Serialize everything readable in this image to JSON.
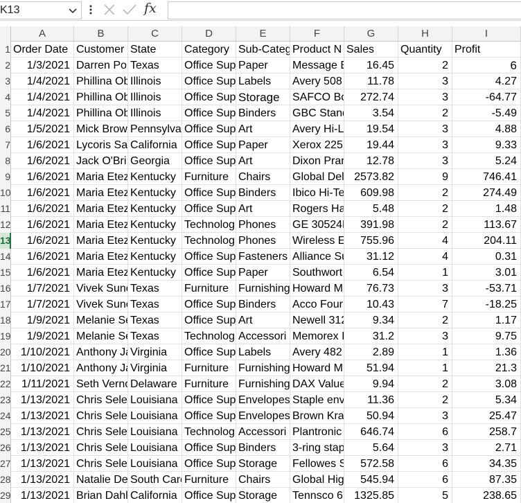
{
  "formula_bar": {
    "name_box": "K13",
    "formula": ""
  },
  "columns": [
    {
      "letter": "A"
    },
    {
      "letter": "B"
    },
    {
      "letter": "C"
    },
    {
      "letter": "D"
    },
    {
      "letter": "E"
    },
    {
      "letter": "F"
    },
    {
      "letter": "G"
    },
    {
      "letter": "H"
    },
    {
      "letter": "I"
    }
  ],
  "selected_row": 13,
  "rows": [
    {
      "n": "1",
      "cells": [
        "Order Date",
        "Customer",
        "State",
        "Category",
        "Sub-Categ",
        "Product N",
        "Sales",
        "Quantity",
        "Profit"
      ]
    },
    {
      "n": "2",
      "cells": [
        "1/3/2021",
        "Darren Po",
        "Texas",
        "Office Sup",
        "Paper",
        "Message E",
        "16.45",
        "2",
        "6"
      ]
    },
    {
      "n": "3",
      "cells": [
        "1/4/2021",
        "Phillina Ob",
        "Illinois",
        "Office Sup",
        "Labels",
        "Avery 508",
        "11.78",
        "3",
        "4.27"
      ]
    },
    {
      "n": "4",
      "cells": [
        "1/4/2021",
        "Phillina Ob",
        "Illinois",
        "Office Sup",
        "Storage",
        "SAFCO Bo",
        "272.74",
        "3",
        "-64.77"
      ]
    },
    {
      "n": "5",
      "cells": [
        "1/4/2021",
        "Phillina Ob",
        "Illinois",
        "Office Sup",
        "Binders",
        "GBC Stand",
        "3.54",
        "2",
        "-5.49"
      ]
    },
    {
      "n": "6",
      "cells": [
        "1/5/2021",
        "Mick Brow",
        "Pennsylvai",
        "Office Sup",
        "Art",
        "Avery Hi-Li",
        "19.54",
        "3",
        "4.88"
      ]
    },
    {
      "n": "7",
      "cells": [
        "1/6/2021",
        "Lycoris Sa",
        "California",
        "Office Sup",
        "Paper",
        "Xerox 225",
        "19.44",
        "3",
        "9.33"
      ]
    },
    {
      "n": "8",
      "cells": [
        "1/6/2021",
        "Jack O'Bri",
        "Georgia",
        "Office Sup",
        "Art",
        "Dixon Prar",
        "12.78",
        "3",
        "5.24"
      ]
    },
    {
      "n": "9",
      "cells": [
        "1/6/2021",
        "Maria Etez",
        "Kentucky",
        "Furniture",
        "Chairs",
        "Global Del",
        "2573.82",
        "9",
        "746.41"
      ]
    },
    {
      "n": "10",
      "cells": [
        "1/6/2021",
        "Maria Etez",
        "Kentucky",
        "Office Sup",
        "Binders",
        "Ibico Hi-Te",
        "609.98",
        "2",
        "274.49"
      ]
    },
    {
      "n": "11",
      "cells": [
        "1/6/2021",
        "Maria Etez",
        "Kentucky",
        "Office Sup",
        "Art",
        "Rogers Ha",
        "5.48",
        "2",
        "1.48"
      ]
    },
    {
      "n": "12",
      "cells": [
        "1/6/2021",
        "Maria Etez",
        "Kentucky",
        "Technolog",
        "Phones",
        "GE 30524E",
        "391.98",
        "2",
        "113.67"
      ]
    },
    {
      "n": "13",
      "cells": [
        "1/6/2021",
        "Maria Etez",
        "Kentucky",
        "Technolog",
        "Phones",
        "Wireless E",
        "755.96",
        "4",
        "204.11"
      ]
    },
    {
      "n": "14",
      "cells": [
        "1/6/2021",
        "Maria Etez",
        "Kentucky",
        "Office Sup",
        "Fasteners",
        "Alliance Su",
        "31.12",
        "4",
        "0.31"
      ]
    },
    {
      "n": "15",
      "cells": [
        "1/6/2021",
        "Maria Etez",
        "Kentucky",
        "Office Sup",
        "Paper",
        "Southwort",
        "6.54",
        "1",
        "3.01"
      ]
    },
    {
      "n": "16",
      "cells": [
        "1/7/2021",
        "Vivek Sunc",
        "Texas",
        "Furniture",
        "Furnishing",
        "Howard M",
        "76.73",
        "3",
        "-53.71"
      ]
    },
    {
      "n": "17",
      "cells": [
        "1/7/2021",
        "Vivek Sunc",
        "Texas",
        "Office Sup",
        "Binders",
        "Acco Four",
        "10.43",
        "7",
        "-18.25"
      ]
    },
    {
      "n": "18",
      "cells": [
        "1/9/2021",
        "Melanie Se",
        "Texas",
        "Office Sup",
        "Art",
        "Newell 312",
        "9.34",
        "2",
        "1.17"
      ]
    },
    {
      "n": "19",
      "cells": [
        "1/9/2021",
        "Melanie Se",
        "Texas",
        "Technolog",
        "Accessori",
        "Memorex I",
        "31.2",
        "3",
        "9.75"
      ]
    },
    {
      "n": "20",
      "cells": [
        "1/10/2021",
        "Anthony Ja",
        "Virginia",
        "Office Sup",
        "Labels",
        "Avery 482",
        "2.89",
        "1",
        "1.36"
      ]
    },
    {
      "n": "21",
      "cells": [
        "1/10/2021",
        "Anthony Ja",
        "Virginia",
        "Furniture",
        "Furnishing",
        "Howard M",
        "51.94",
        "1",
        "21.3"
      ]
    },
    {
      "n": "22",
      "cells": [
        "1/11/2021",
        "Seth Verno",
        "Delaware",
        "Furniture",
        "Furnishing",
        "DAX Value",
        "9.94",
        "2",
        "3.08"
      ]
    },
    {
      "n": "23",
      "cells": [
        "1/13/2021",
        "Chris Sele:",
        "Louisiana",
        "Office Sup",
        "Envelopes",
        "Staple env",
        "11.36",
        "2",
        "5.34"
      ]
    },
    {
      "n": "24",
      "cells": [
        "1/13/2021",
        "Chris Sele:",
        "Louisiana",
        "Office Sup",
        "Envelopes",
        "Brown Kra",
        "50.94",
        "3",
        "25.47"
      ]
    },
    {
      "n": "25",
      "cells": [
        "1/13/2021",
        "Chris Sele:",
        "Louisiana",
        "Technolog",
        "Accessori",
        "Plantronic",
        "646.74",
        "6",
        "258.7"
      ]
    },
    {
      "n": "26",
      "cells": [
        "1/13/2021",
        "Chris Sele:",
        "Louisiana",
        "Office Sup",
        "Binders",
        "3-ring stap",
        "5.64",
        "3",
        "2.71"
      ]
    },
    {
      "n": "27",
      "cells": [
        "1/13/2021",
        "Chris Sele:",
        "Louisiana",
        "Office Sup",
        "Storage",
        "Fellowes S",
        "572.58",
        "6",
        "34.35"
      ]
    },
    {
      "n": "28",
      "cells": [
        "1/13/2021",
        "Natalie De",
        "South Carc",
        "Furniture",
        "Chairs",
        "Global Hig",
        "545.94",
        "6",
        "87.35"
      ]
    },
    {
      "n": "29",
      "cells": [
        "1/13/2021",
        "Brian Dahl",
        "California",
        "Office Sup",
        "Storage",
        "Tennsco 6",
        "1325.85",
        "5",
        "238.65"
      ]
    }
  ]
}
